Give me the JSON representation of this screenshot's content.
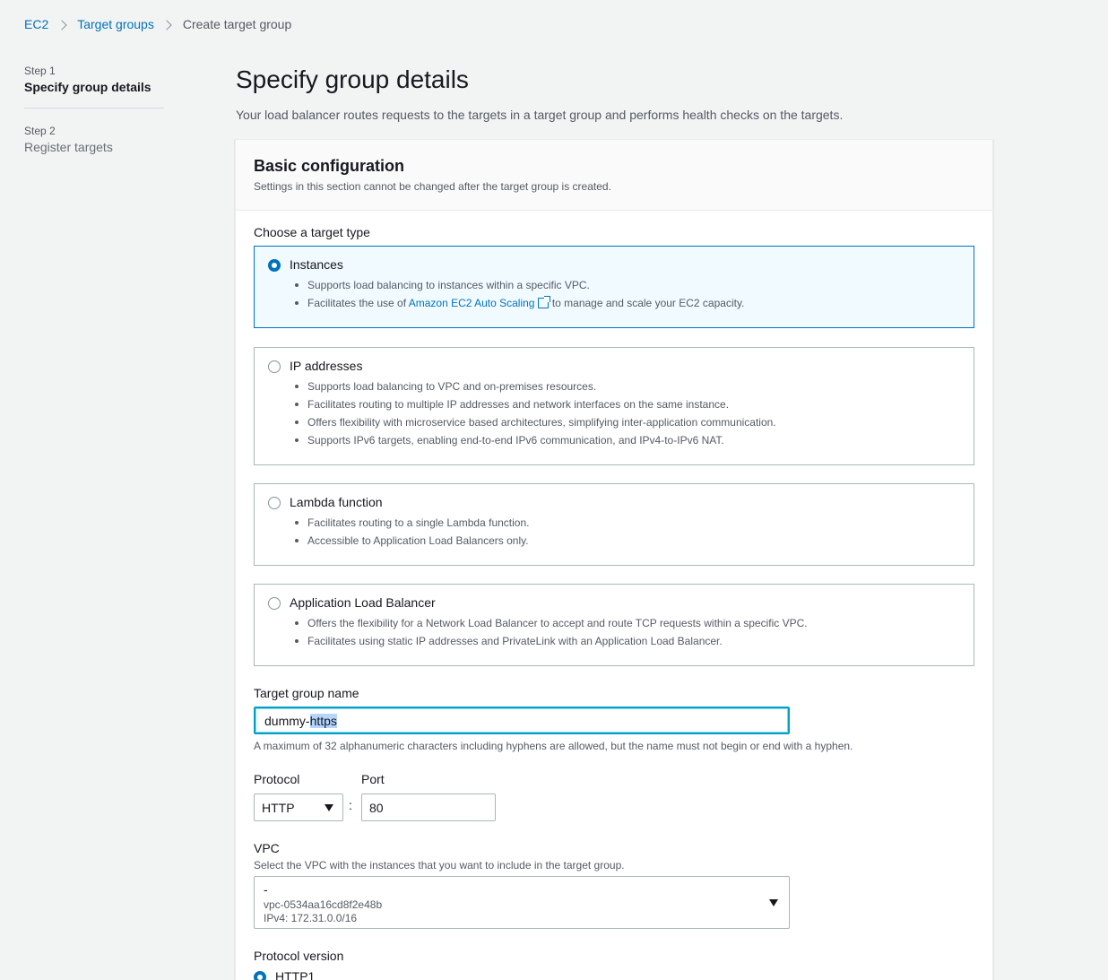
{
  "breadcrumb": {
    "items": [
      "EC2",
      "Target groups"
    ],
    "current": "Create target group"
  },
  "steps": [
    {
      "num": "Step 1",
      "title": "Specify group details",
      "active": true
    },
    {
      "num": "Step 2",
      "title": "Register targets",
      "active": false
    }
  ],
  "page": {
    "title": "Specify group details",
    "description": "Your load balancer routes requests to the targets in a target group and performs health checks on the targets."
  },
  "panel": {
    "title": "Basic configuration",
    "subtitle": "Settings in this section cannot be changed after the target group is created."
  },
  "target_type": {
    "label": "Choose a target type",
    "selected": "Instances",
    "options": [
      {
        "title": "Instances",
        "bullets": [
          "Supports load balancing to instances within a specific VPC."
        ],
        "bullet2_prefix": "Facilitates the use of ",
        "bullet2_link": "Amazon EC2 Auto Scaling",
        "bullet2_suffix": " to manage and scale your EC2 capacity."
      },
      {
        "title": "IP addresses",
        "bullets": [
          "Supports load balancing to VPC and on-premises resources.",
          "Facilitates routing to multiple IP addresses and network interfaces on the same instance.",
          "Offers flexibility with microservice based architectures, simplifying inter-application communication.",
          "Supports IPv6 targets, enabling end-to-end IPv6 communication, and IPv4-to-IPv6 NAT."
        ]
      },
      {
        "title": "Lambda function",
        "bullets": [
          "Facilitates routing to a single Lambda function.",
          "Accessible to Application Load Balancers only."
        ]
      },
      {
        "title": "Application Load Balancer",
        "bullets": [
          "Offers the flexibility for a Network Load Balancer to accept and route TCP requests within a specific VPC.",
          "Facilitates using static IP addresses and PrivateLink with an Application Load Balancer."
        ]
      }
    ]
  },
  "target_group_name": {
    "label": "Target group name",
    "value_plain": "dummy-",
    "value_selected": "https",
    "hint": "A maximum of 32 alphanumeric characters including hyphens are allowed, but the name must not begin or end with a hyphen."
  },
  "protocol": {
    "label": "Protocol",
    "value": "HTTP"
  },
  "port": {
    "label": "Port",
    "value": "80",
    "separator": ":"
  },
  "vpc": {
    "label": "VPC",
    "hint": "Select the VPC with the instances that you want to include in the target group.",
    "name": "-",
    "id": "vpc-0534aa16cd8f2e48b",
    "cidr": "IPv4: 172.31.0.0/16"
  },
  "protocol_version": {
    "label": "Protocol version",
    "first_option": "HTTP1"
  },
  "colors": {
    "link": "#0073bb",
    "selected_tile_bg": "#f1faff",
    "focus": "#00a1c9"
  }
}
